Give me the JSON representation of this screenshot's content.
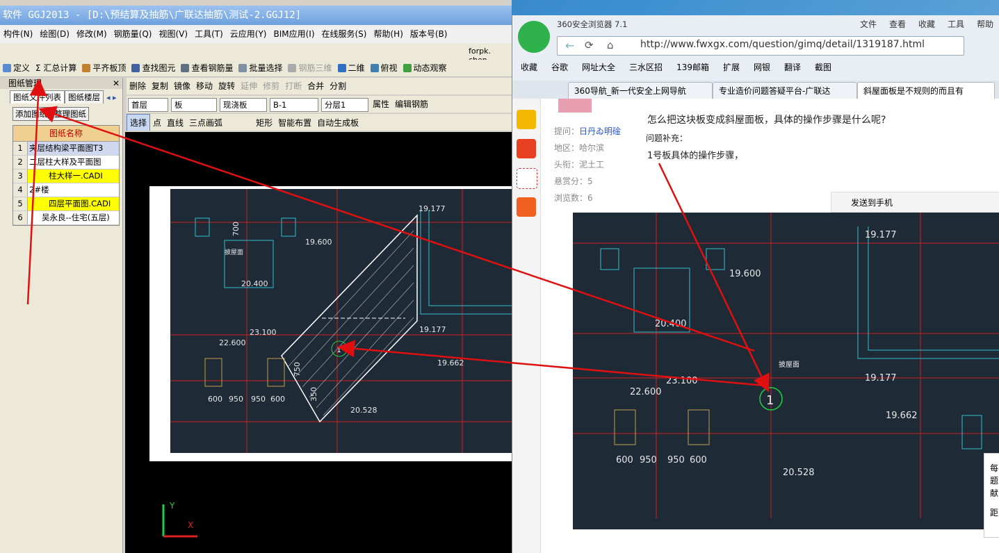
{
  "app": {
    "title": "软件 GGJ2013 - [D:\\预结算及抽筋\\广联达抽筋\\测试-2.GGJ12]",
    "menus": [
      "构件(N)",
      "绘图(D)",
      "修改(M)",
      "钢筋量(Q)",
      "视图(V)",
      "工具(T)",
      "云应用(Y)",
      "BIM应用(I)",
      "在线服务(S)",
      "帮助(H)",
      "版本号(B)"
    ],
    "status_text": "forpk. chen",
    "toolbar1": [
      "定义",
      "Σ 汇总计算",
      "平齐板顶",
      "查找图元",
      "查看钢筋量",
      "批量选择",
      "钢筋三维",
      "二维",
      "俯视",
      "动态观察"
    ],
    "toolbar2": [
      "删除",
      "复制",
      "镜像",
      "移动",
      "旋转",
      "延伸",
      "修剪",
      "打断",
      "合并",
      "分割"
    ],
    "toolbar3": {
      "floor": "首层",
      "type": "板",
      "subtype": "现浇板",
      "item": "B-1",
      "layer": "分层1",
      "props": "属性",
      "edit": "编辑钢筋"
    },
    "toolbar4": [
      "选择",
      "点",
      "直线",
      "三点画弧",
      "矩形",
      "智能布置",
      "自动生成板"
    ],
    "panel": {
      "title": "图纸管理",
      "tabs": [
        "图纸文件列表",
        "图纸楼层"
      ],
      "buttons": [
        "添加图纸",
        "整理图纸"
      ],
      "table_header": "图纸名称",
      "rows": [
        {
          "num": "1",
          "name": "夹层结构梁平面图T3"
        },
        {
          "num": "2",
          "name": "二层柱大样及平面图"
        },
        {
          "num": "3",
          "name": "柱大样一.CADI"
        },
        {
          "num": "4",
          "name": "2#楼"
        },
        {
          "num": "5",
          "name": "四层平面图.CADI"
        },
        {
          "num": "6",
          "name": "吴永良--住宅(五层)"
        }
      ]
    },
    "cad": {
      "labels": [
        "19.177",
        "700",
        "19.600",
        "20.400",
        "23.100",
        "22.600",
        "600",
        "950",
        "950",
        "600",
        "19.177",
        "19.662",
        "20.528",
        "750",
        "350",
        "1"
      ],
      "slope_label": "披屋面"
    }
  },
  "browser": {
    "title": "360安全浏览器 7.1",
    "menu": [
      "文件",
      "查看",
      "收藏",
      "工具",
      "帮助"
    ],
    "url": "http://www.fwxgx.com/question/gimq/detail/1319187.html",
    "bookmarks": [
      "收藏",
      "谷歌",
      "网址大全",
      "三水区招",
      "139邮箱",
      "扩展",
      "网银",
      "翻译",
      "截图"
    ],
    "tabs": [
      "360导航_新一代安全上网导航",
      "专业造价问题答疑平台-广联达",
      "斜屋面板是不规则的而且有"
    ],
    "meta": [
      {
        "label": "提问：",
        "value": "日丹ゐ明碒"
      },
      {
        "label": "地区：",
        "value": "哈尔滨"
      },
      {
        "label": "头衔：",
        "value": "泥土工"
      },
      {
        "label": "悬赏分：",
        "value": "5"
      },
      {
        "label": "浏览数：",
        "value": "6"
      }
    ],
    "question": "怎么把这块板变成斜屋面板，具体的操作步骤是什么呢?",
    "supp_label": "问题补充：",
    "supp_text": "1号板具体的操作步骤，",
    "share_btn": "发送到手机",
    "float_text": [
      "每",
      "题",
      "献",
      "距"
    ]
  },
  "colors": {
    "arrow": "#e01010",
    "cad_bg": "#1e2a36",
    "cad_line_red": "#d02020",
    "cad_line_cyan": "#30c0d0",
    "cad_green": "#20d040"
  }
}
